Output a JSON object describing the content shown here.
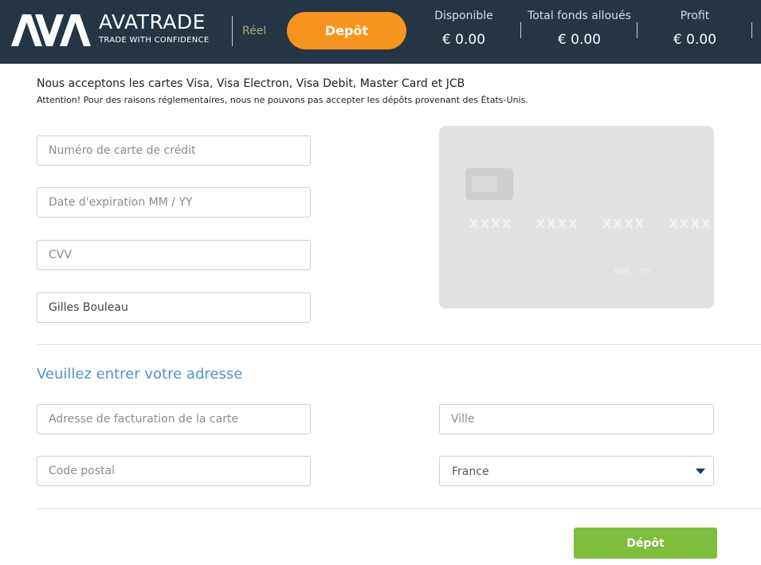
{
  "header": {
    "brand_name": "AVATRADE",
    "brand_tagline": "TRADE WITH CONFIDENCE",
    "account_mode": "Réel",
    "deposit_button": "Depôt",
    "stats": [
      {
        "label": "Disponible",
        "value": "€ 0.00"
      },
      {
        "label": "Total fonds alloués",
        "value": "€ 0.00"
      },
      {
        "label": "Profit",
        "value": "€ 0.00"
      }
    ]
  },
  "notice": {
    "accepted_cards": "Nous acceptons les cartes Visa, Visa Electron, Visa Debit, Master Card et JCB",
    "attention": "Attention! Pour des raisons réglementaires, nous ne pouvons pas accepter les dépôts provenant des États-Unis."
  },
  "card_form": {
    "card_number_placeholder": "Numéro de carte de crédit",
    "expiry_placeholder": "Date d'expiration MM / YY",
    "cvv_placeholder": "CVV",
    "cardholder_value": "Gilles Bouleau"
  },
  "card_preview": {
    "number": "XXXX XXXX XXXX XXXX",
    "expiry": "MM / YY"
  },
  "address_form": {
    "heading": "Veuillez entrer votre adresse",
    "billing_address_placeholder": "Adresse de facturation de la carte",
    "city_placeholder": "Ville",
    "postal_code_placeholder": "Code postal",
    "country_selected": "France"
  },
  "footer": {
    "deposit_button": "Dépôt"
  },
  "colors": {
    "header_bg": "#243546",
    "deposit_orange": "#f7941d",
    "deposit_green": "#7cbe3e",
    "heading_blue": "#4f94c5"
  }
}
